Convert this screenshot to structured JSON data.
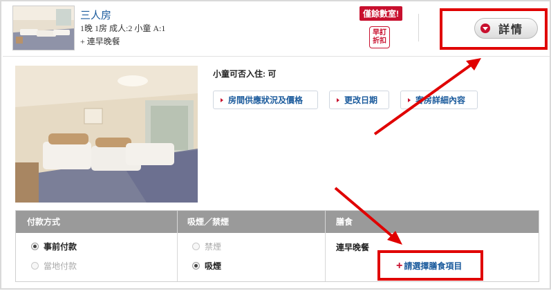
{
  "room": {
    "name": "三人房",
    "details_line": "1晚 1房 成人:2 小童 A:1",
    "meal_line": "+ 連早晚餐"
  },
  "badges": {
    "few_rooms": "僅餘數室!",
    "early_discount_line1": "早訂",
    "early_discount_line2": "折扣"
  },
  "details_button": {
    "label": "詳情"
  },
  "children_info": "小童可否入住: 可",
  "links": [
    {
      "label": "房間供應狀況及價格"
    },
    {
      "label": "更改日期"
    },
    {
      "label": "客房詳細內容"
    }
  ],
  "options": {
    "headers": [
      "付款方式",
      "吸煙／禁煙",
      "膳食"
    ],
    "payment": [
      {
        "label": "事前付款",
        "checked": true,
        "disabled": false
      },
      {
        "label": "當地付款",
        "checked": false,
        "disabled": true
      }
    ],
    "smoking": [
      {
        "label": "禁煙",
        "checked": false,
        "disabled": true
      },
      {
        "label": "吸煙",
        "checked": true,
        "disabled": false
      }
    ],
    "meal_name": "連早晚餐",
    "meal_select_label": "請選擇膳食項目"
  },
  "colors": {
    "accent_red": "#c8102e",
    "link_blue": "#1a5a9c",
    "annotation_red": "#e00000",
    "table_header": "#9a9a9a"
  },
  "icons": [
    "chevron-down-icon",
    "plus-icon",
    "triangle-bullet-icon"
  ]
}
